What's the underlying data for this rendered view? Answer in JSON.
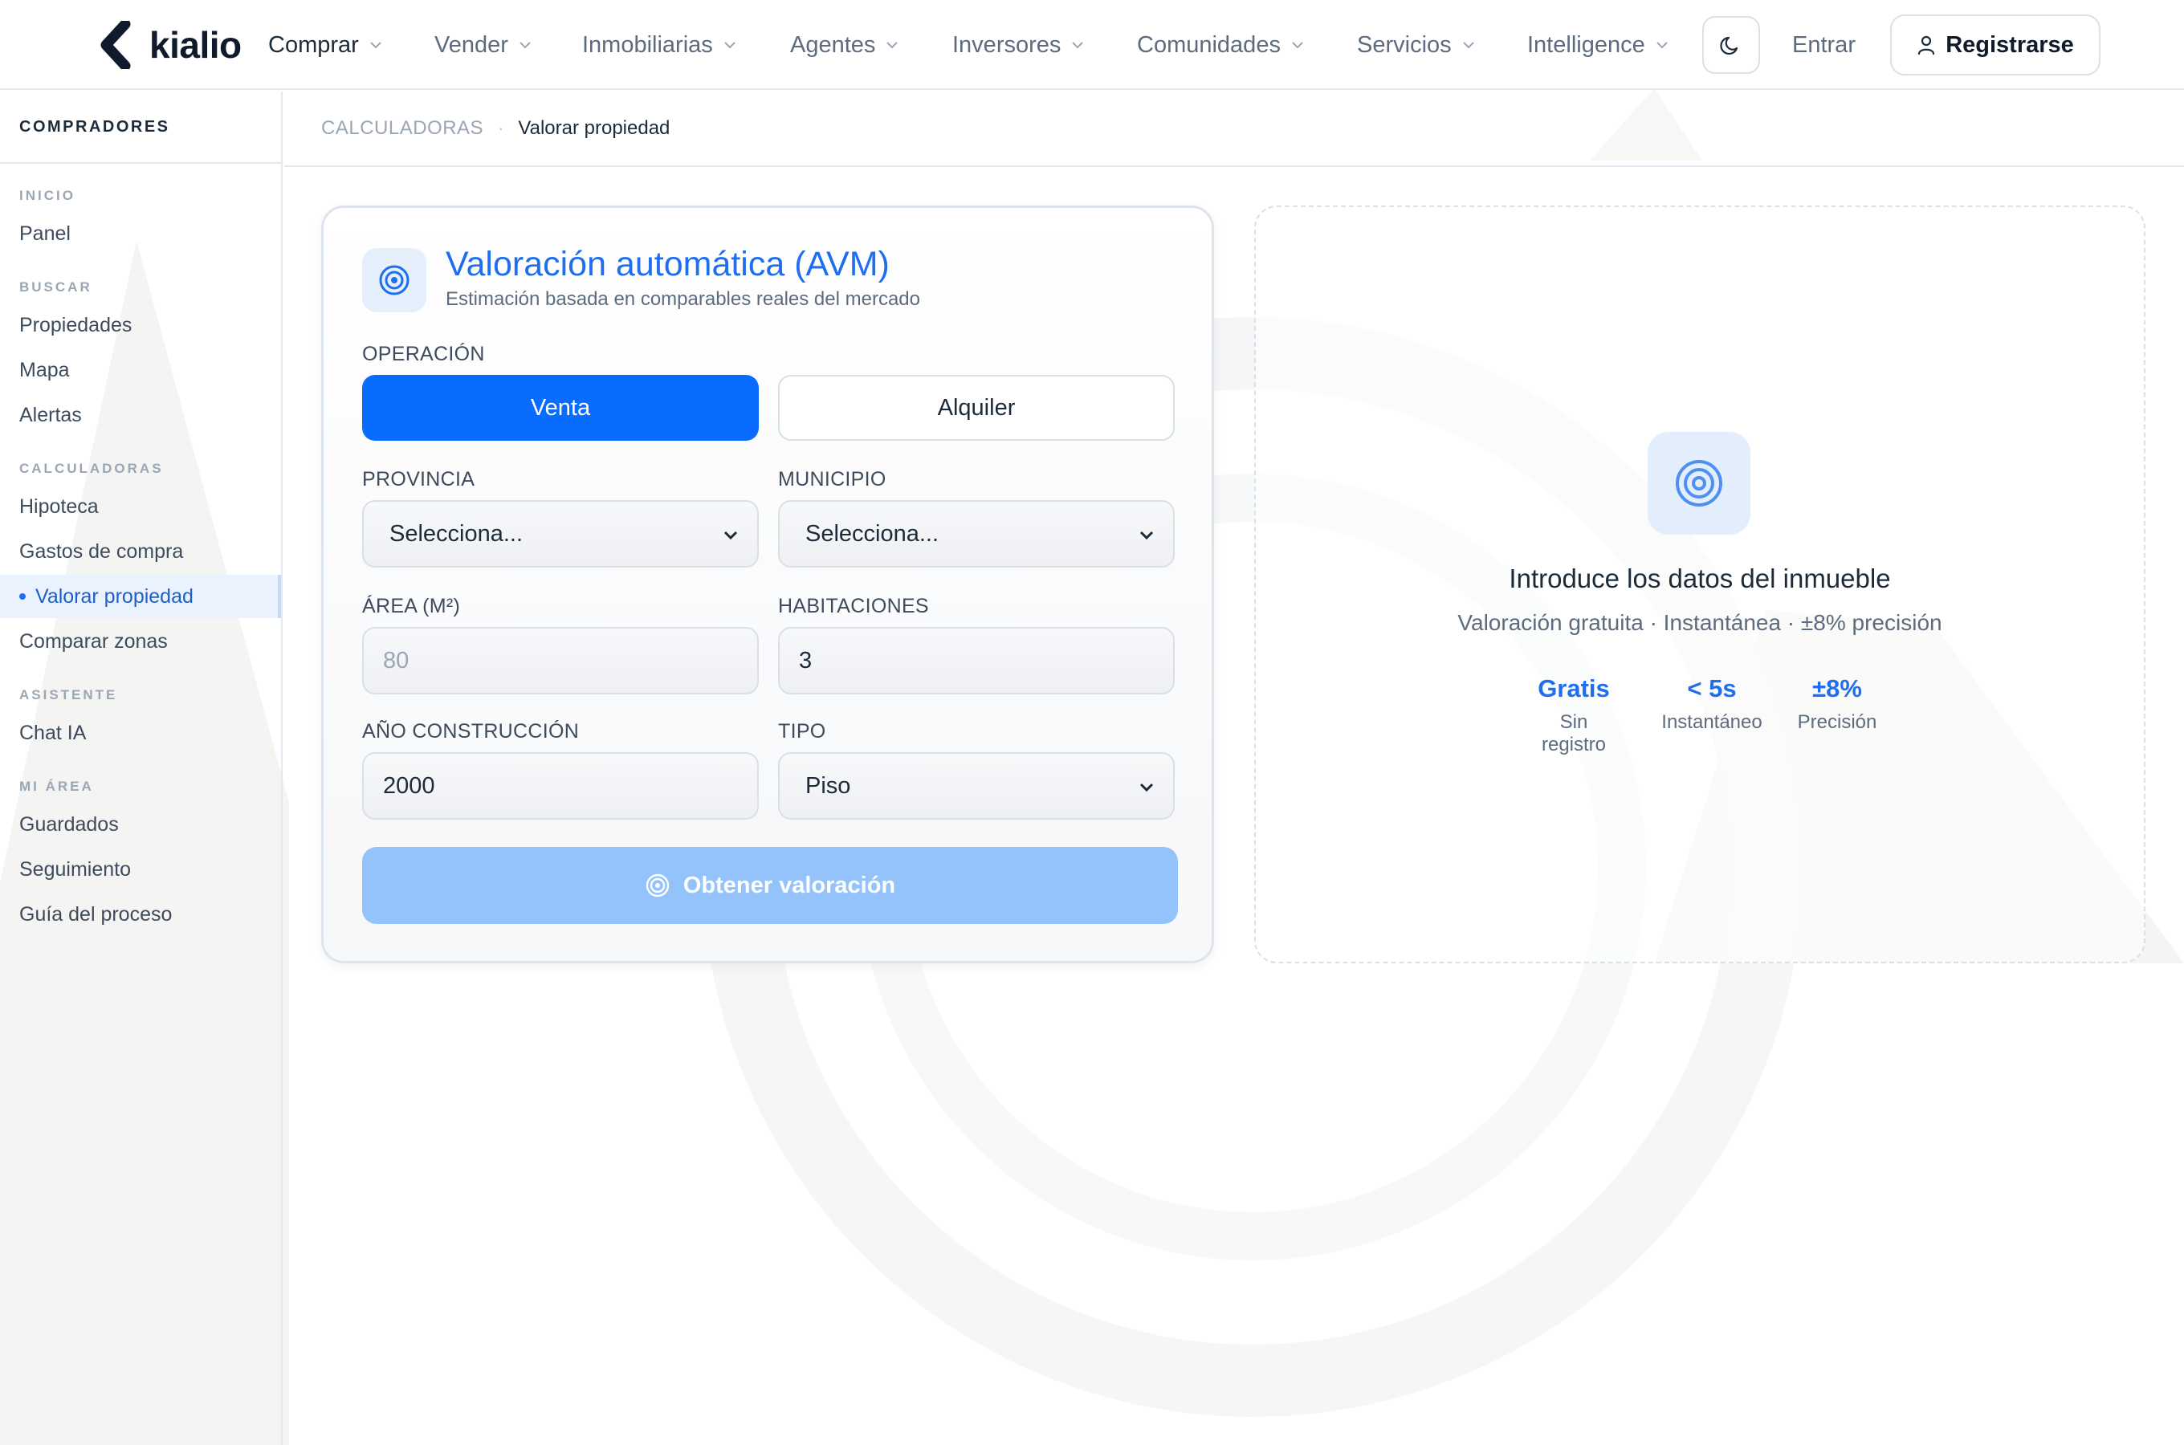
{
  "brand": {
    "name": "kialio"
  },
  "nav": {
    "items": [
      {
        "label": "Comprar"
      },
      {
        "label": "Vender"
      },
      {
        "label": "Inmobiliarias"
      },
      {
        "label": "Agentes"
      },
      {
        "label": "Inversores"
      },
      {
        "label": "Comunidades"
      },
      {
        "label": "Servicios"
      },
      {
        "label": "Intelligence"
      }
    ],
    "login": "Entrar",
    "signup": "Registrarse"
  },
  "sidebar": {
    "header": "COMPRADORES",
    "sections": [
      {
        "title": "INICIO",
        "items": [
          "Panel"
        ]
      },
      {
        "title": "BUSCAR",
        "items": [
          "Propiedades",
          "Mapa",
          "Alertas"
        ]
      },
      {
        "title": "CALCULADORAS",
        "items": [
          "Hipoteca",
          "Gastos de compra",
          "Valorar propiedad",
          "Comparar zonas"
        ]
      },
      {
        "title": "ASISTENTE",
        "items": [
          "Chat IA"
        ]
      },
      {
        "title": "MI ÁREA",
        "items": [
          "Guardados",
          "Seguimiento",
          "Guía del proceso"
        ]
      }
    ],
    "active": "Valorar propiedad"
  },
  "breadcrumb": {
    "root": "CALCULADORAS",
    "separator": "·",
    "current": "Valorar propiedad"
  },
  "form": {
    "title": "Valoración automática (AVM)",
    "subtitle": "Estimación basada en comparables reales del mercado",
    "operation_label": "OPERACIÓN",
    "operation_options": [
      "Venta",
      "Alquiler"
    ],
    "operation_selected": "Venta",
    "province_label": "PROVINCIA",
    "province_value": "Selecciona...",
    "municipality_label": "MUNICIPIO",
    "municipality_value": "Selecciona...",
    "area_label": "ÁREA (M²)",
    "area_placeholder": "80",
    "rooms_label": "HABITACIONES",
    "rooms_value": "3",
    "year_label": "AÑO CONSTRUCCIÓN",
    "year_value": "2000",
    "type_label": "TIPO",
    "type_value": "Piso",
    "submit_label": "Obtener valoración"
  },
  "result": {
    "title": "Introduce los datos del inmueble",
    "subtitle": "Valoración gratuita · Instantánea · ±8% precisión",
    "stats": [
      {
        "value": "Gratis",
        "label": "Sin registro"
      },
      {
        "value": "< 5s",
        "label": "Instantáneo"
      },
      {
        "value": "±8%",
        "label": "Precisión"
      }
    ]
  },
  "colors": {
    "accent": "#0a6cff",
    "accent_soft": "#94c3fb",
    "text_dark": "#1c2b3a",
    "text_muted": "#5d6b7e",
    "border": "#d9e0e8"
  },
  "icons": {
    "logo": "kialio-logo-icon",
    "nav_chevron": "chevron-down-icon",
    "theme": "moon-icon",
    "user": "user-icon",
    "target": "target-icon",
    "select_caret": "chevron-down-icon"
  }
}
